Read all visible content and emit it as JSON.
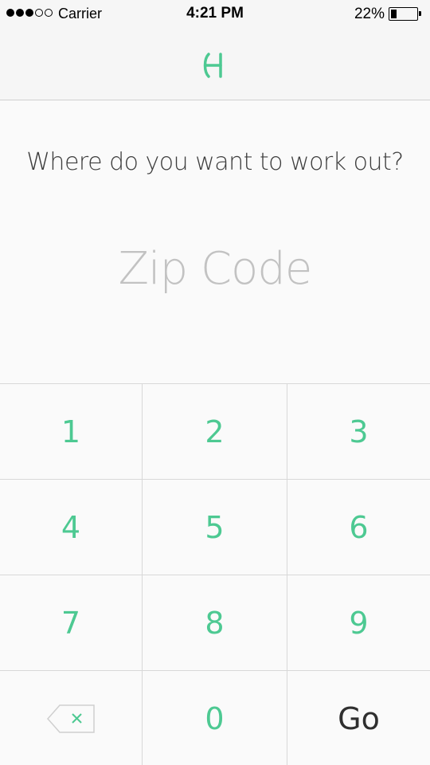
{
  "status_bar": {
    "carrier": "Carrier",
    "time": "4:21 PM",
    "battery_pct": "22%",
    "battery_level": 0.22,
    "signal_strength": 3,
    "signal_max": 5
  },
  "nav": {
    "logo_icon": "h-logo-icon",
    "accent_color": "#4dc992"
  },
  "main": {
    "prompt": "Where do you want to work out?",
    "zip_placeholder": "Zip Code"
  },
  "keypad": {
    "keys": [
      "1",
      "2",
      "3",
      "4",
      "5",
      "6",
      "7",
      "8",
      "9"
    ],
    "zero": "0",
    "go": "Go",
    "backspace_icon": "backspace-icon"
  }
}
